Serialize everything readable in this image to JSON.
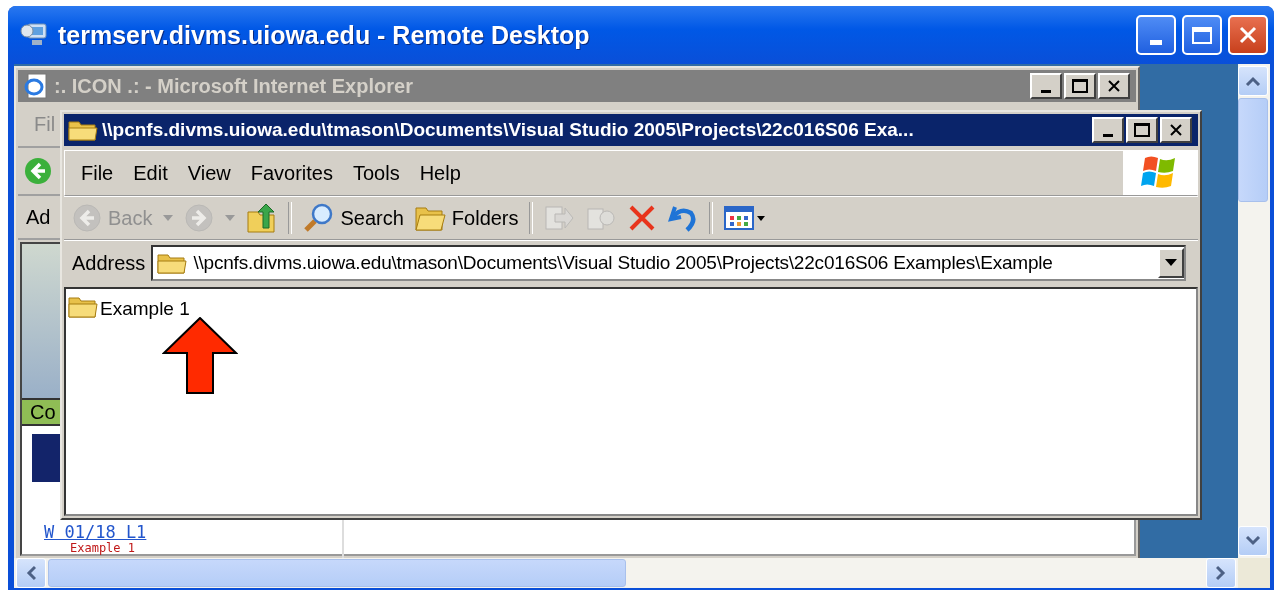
{
  "remote_desktop": {
    "title": "termserv.divms.uiowa.edu - Remote Desktop"
  },
  "browser": {
    "title": ":. ICON .: - Microsoft Internet Explorer",
    "active": false,
    "menu_fragment": "Fil",
    "address_fragment": "Ad",
    "page": {
      "banner_fragment": "Co",
      "link": "W 01/18 L1",
      "list_item": "Example 1"
    }
  },
  "explorer": {
    "title": "\\\\pcnfs.divms.uiowa.edu\\tmason\\Documents\\Visual Studio 2005\\Projects\\22c016S06 Exa...",
    "active": true,
    "menu": [
      "File",
      "Edit",
      "View",
      "Favorites",
      "Tools",
      "Help"
    ],
    "toolbar": [
      {
        "kind": "back",
        "label": "Back",
        "disabled": true
      },
      {
        "kind": "forward",
        "disabled": true
      },
      {
        "kind": "up",
        "disabled": false
      },
      {
        "kind": "separator"
      },
      {
        "kind": "search",
        "label": "Search",
        "disabled": false
      },
      {
        "kind": "folders",
        "label": "Folders",
        "disabled": false
      },
      {
        "kind": "separator"
      },
      {
        "kind": "move",
        "disabled": true
      },
      {
        "kind": "copy",
        "disabled": true
      },
      {
        "kind": "delete",
        "disabled": false
      },
      {
        "kind": "undo",
        "disabled": false
      },
      {
        "kind": "separator"
      },
      {
        "kind": "views",
        "disabled": false
      }
    ],
    "address": {
      "label": "Address",
      "value": "\\\\pcnfs.divms.uiowa.edu\\tmason\\Documents\\Visual Studio 2005\\Projects\\22c016S06 Examples\\Example"
    },
    "items": [
      {
        "name": "Example 1"
      }
    ]
  }
}
